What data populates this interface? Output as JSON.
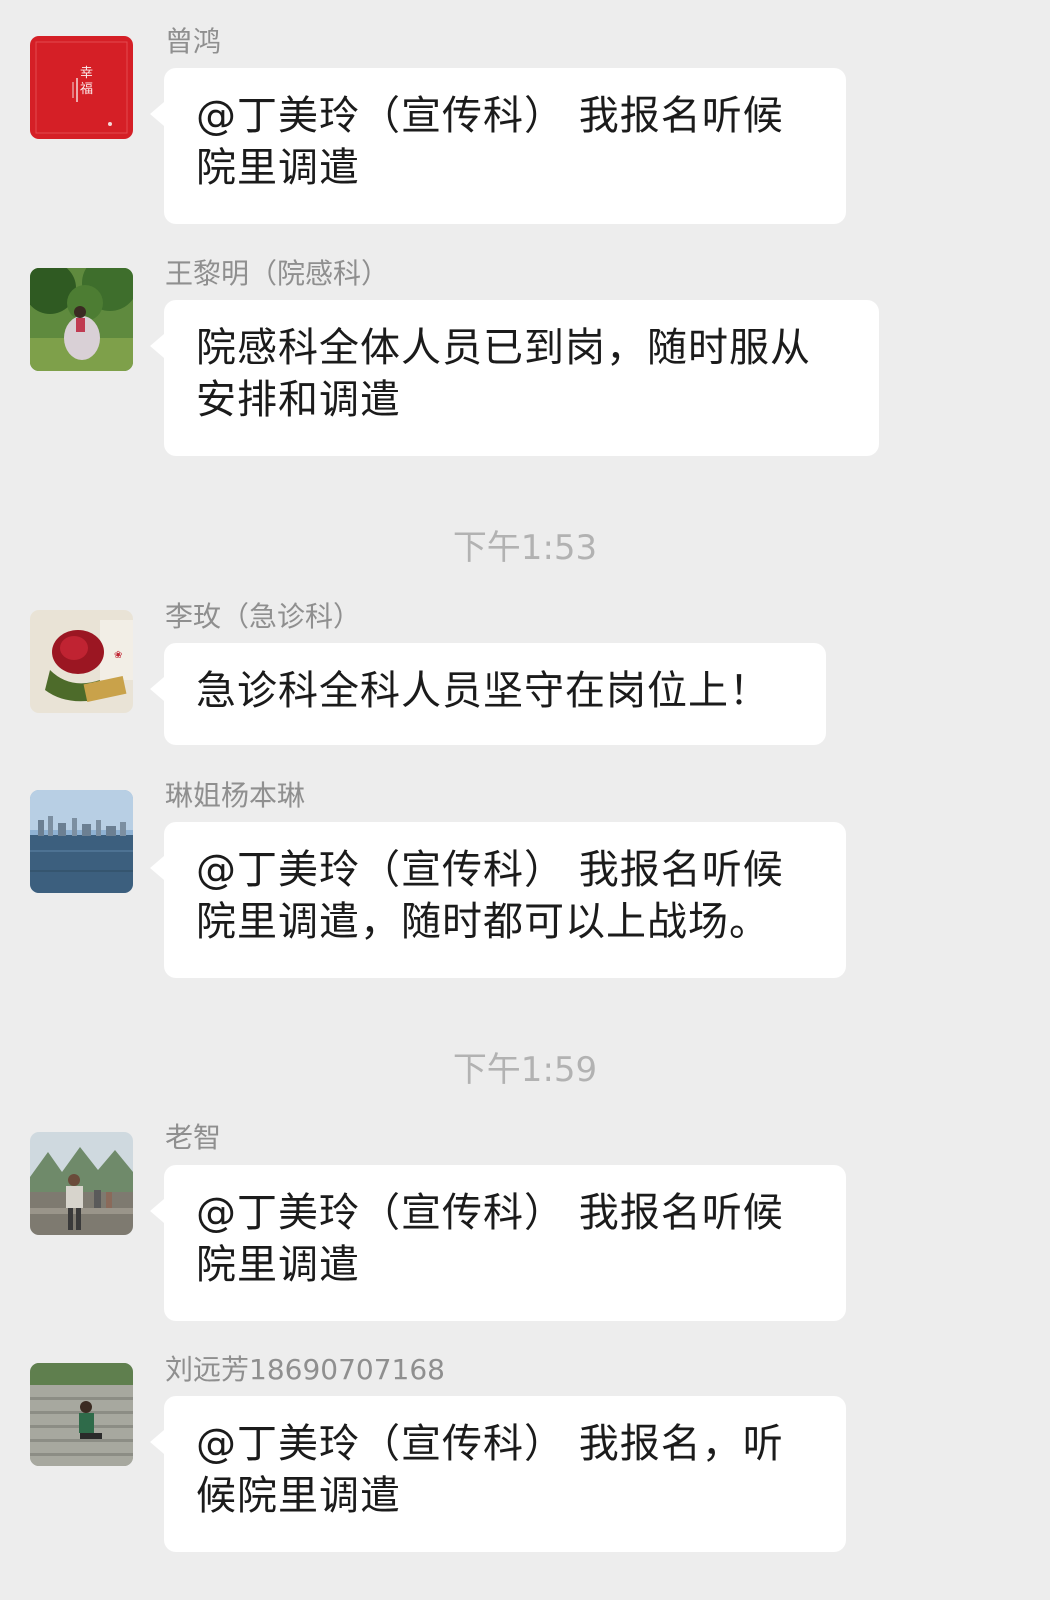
{
  "messages": [
    {
      "sender": "曾鸿",
      "avatar_icon": "red-fortune-card-avatar-icon",
      "avatar_text": "幸福",
      "text_lines": [
        "@丁美玲（宣传科） 我报名听候",
        "院里调遣"
      ]
    },
    {
      "sender": "王黎明（院感科）",
      "avatar_icon": "forest-person-avatar-icon",
      "text_lines": [
        "院感科全体人员已到岗，随时服从",
        "安排和调遣"
      ]
    },
    {
      "sender": "李玫（急诊科）",
      "avatar_icon": "red-rose-avatar-icon",
      "text_lines": [
        "急诊科全科人员坚守在岗位上！"
      ]
    },
    {
      "sender": "琳姐杨本琳",
      "avatar_icon": "city-waterfront-avatar-icon",
      "text_lines": [
        "@丁美玲（宣传科） 我报名听候",
        "院里调遣，随时都可以上战场。"
      ]
    },
    {
      "sender": "老智",
      "avatar_icon": "mountain-person-avatar-icon",
      "text_lines": [
        "@丁美玲（宣传科） 我报名听候",
        "院里调遣"
      ]
    },
    {
      "sender": "刘远芳18690707168",
      "avatar_icon": "stairs-person-avatar-icon",
      "text_lines": [
        "@丁美玲（宣传科） 我报名，听",
        "候院里调遣"
      ]
    }
  ],
  "timestamps": [
    "下午1:53",
    "下午1:59"
  ],
  "colors": {
    "background": "#ededed",
    "bubble": "#ffffff",
    "sender_text": "#8f8f8f",
    "timestamp_text": "#b2b2b2",
    "avatar_red": "#d51f26"
  }
}
